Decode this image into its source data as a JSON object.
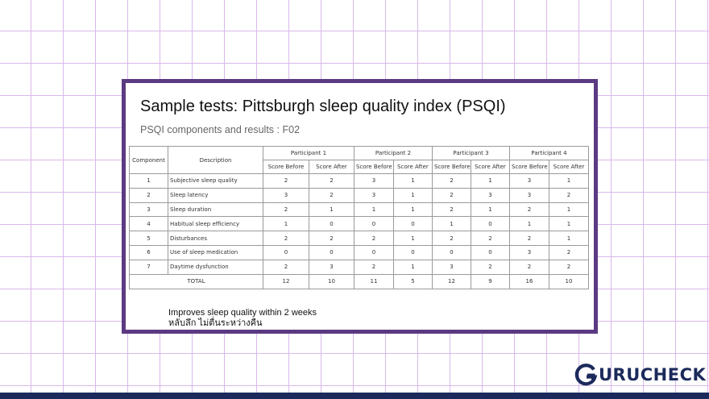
{
  "slide": {
    "title": "Sample tests: Pittsburgh sleep quality index (PSQI)",
    "subtitle": "PSQI components and results : F02"
  },
  "table": {
    "col_component": "Component",
    "col_description": "Description",
    "participants": [
      "Participant 1",
      "Participant 2",
      "Participant 3",
      "Participant 4"
    ],
    "score_before": "Score Before",
    "score_after": "Score After",
    "rows": [
      {
        "component": "1",
        "description": "Subjective sleep quality",
        "scores": [
          "2",
          "2",
          "3",
          "1",
          "2",
          "1",
          "3",
          "1"
        ]
      },
      {
        "component": "2",
        "description": "Sleep latency",
        "scores": [
          "3",
          "2",
          "3",
          "1",
          "2",
          "3",
          "3",
          "2"
        ]
      },
      {
        "component": "3",
        "description": "Sleep duration",
        "scores": [
          "2",
          "1",
          "1",
          "1",
          "2",
          "1",
          "2",
          "1"
        ]
      },
      {
        "component": "4",
        "description": "Habitual sleep efficiency",
        "scores": [
          "1",
          "0",
          "0",
          "0",
          "1",
          "0",
          "1",
          "1"
        ]
      },
      {
        "component": "5",
        "description": "Disturbances",
        "scores": [
          "2",
          "2",
          "2",
          "1",
          "2",
          "2",
          "2",
          "1"
        ]
      },
      {
        "component": "6",
        "description": "Use of sleep medication",
        "scores": [
          "0",
          "0",
          "0",
          "0",
          "0",
          "0",
          "3",
          "2"
        ]
      },
      {
        "component": "7",
        "description": "Daytime dysfunction",
        "scores": [
          "2",
          "3",
          "2",
          "1",
          "3",
          "2",
          "2",
          "2"
        ]
      }
    ],
    "total_label": "TOTAL",
    "totals": [
      "12",
      "10",
      "11",
      "5",
      "12",
      "9",
      "16",
      "10"
    ]
  },
  "footnote": {
    "line1": "Improves sleep quality within 2 weeks",
    "line2": "หลับลึก ไม่ตื่นระหว่างคืน"
  },
  "brand": {
    "logo_text": "URUCHECK",
    "color": "#1b2a5b"
  },
  "theme": {
    "frame_color": "#5b3a82",
    "grid_color": "#d9b8ec"
  }
}
